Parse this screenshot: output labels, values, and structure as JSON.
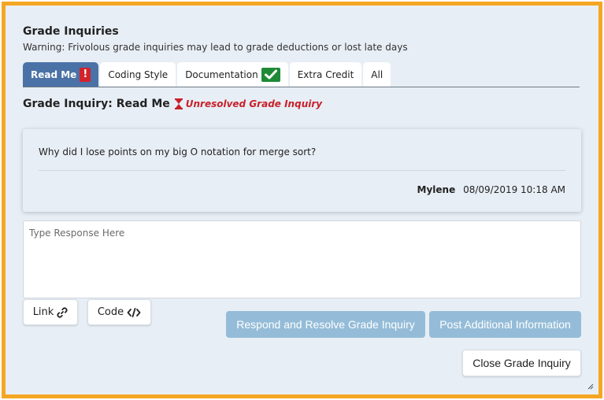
{
  "header": {
    "title": "Grade Inquiries",
    "warning": "Warning: Frivolous grade inquiries may lead to grade deductions or lost late days"
  },
  "tabs": [
    {
      "label": "Read Me",
      "active": true,
      "badge": "!",
      "badge_color": "#d2232a"
    },
    {
      "label": "Coding Style",
      "active": false
    },
    {
      "label": "Documentation",
      "active": false,
      "badge_icon": "check-icon",
      "badge_color": "#1f8a36"
    },
    {
      "label": "Extra Credit",
      "active": false
    },
    {
      "label": "All",
      "active": false
    }
  ],
  "inquiry": {
    "heading": "Grade Inquiry: Read Me",
    "status_icon": "hourglass-icon",
    "status": "Unresolved Grade Inquiry",
    "status_color": "#c8202a"
  },
  "post": {
    "message": "Why did I lose points on my big O notation for merge sort?",
    "author": "Mylene",
    "timestamp": "08/09/2019 10:18 AM"
  },
  "response": {
    "placeholder": "Type Response Here",
    "value": ""
  },
  "toolbar": {
    "link_label": "Link",
    "link_icon": "link-icon",
    "code_label": "Code",
    "code_icon": "code-icon"
  },
  "actions": {
    "respond_resolve": "Respond and Resolve Grade Inquiry",
    "post_additional": "Post Additional Information",
    "close": "Close Grade Inquiry"
  },
  "colors": {
    "frame_border": "#f5a623",
    "active_tab": "#4a72a6",
    "primary_button": "#94bcd8",
    "background": "#e8eef5"
  }
}
